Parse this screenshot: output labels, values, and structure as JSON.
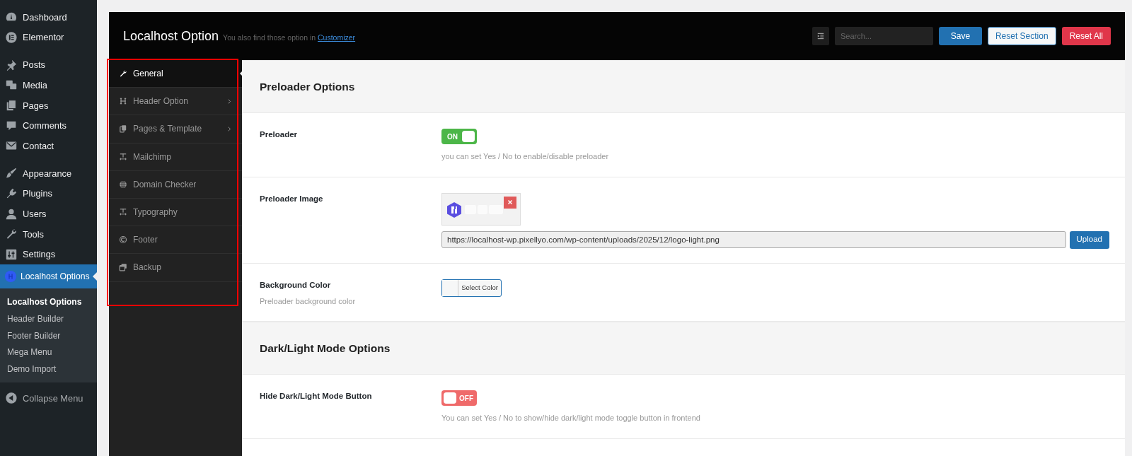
{
  "wp_menu": {
    "groups": [
      [
        {
          "label": "Dashboard",
          "selected": false
        },
        {
          "label": "Elementor",
          "selected": false
        }
      ],
      [
        {
          "label": "Posts",
          "selected": false
        },
        {
          "label": "Media",
          "selected": false
        },
        {
          "label": "Pages",
          "selected": false
        },
        {
          "label": "Comments",
          "selected": false
        },
        {
          "label": "Contact",
          "selected": false
        }
      ],
      [
        {
          "label": "Appearance",
          "selected": false
        },
        {
          "label": "Plugins",
          "selected": false
        },
        {
          "label": "Users",
          "selected": false
        },
        {
          "label": "Tools",
          "selected": false
        },
        {
          "label": "Settings",
          "selected": false
        },
        {
          "label": "Localhost Options",
          "selected": true
        }
      ]
    ],
    "submenu": [
      {
        "label": "Localhost Options",
        "selected": true
      },
      {
        "label": "Header Builder",
        "selected": false
      },
      {
        "label": "Footer Builder",
        "selected": false
      },
      {
        "label": "Mega Menu",
        "selected": false
      },
      {
        "label": "Demo Import",
        "selected": false
      }
    ],
    "collapse": "Collapse Menu"
  },
  "panel": {
    "title": "Localhost Option",
    "subtitle": "You also find those option in ",
    "subtitle_link": "Customizer",
    "search": {
      "placeholder": "Search..."
    },
    "buttons": [
      {
        "label": "Save",
        "kind": "primary"
      },
      {
        "label": "Reset Section",
        "kind": "outline"
      },
      {
        "label": "Reset All",
        "kind": "danger"
      }
    ]
  },
  "options_nav": [
    {
      "label": "General",
      "selected": true,
      "has_submenu": false
    },
    {
      "label": "Header Option",
      "selected": false,
      "has_submenu": true
    },
    {
      "label": "Pages & Template",
      "selected": false,
      "has_submenu": true
    },
    {
      "label": "Mailchimp",
      "selected": false,
      "has_submenu": false
    },
    {
      "label": "Domain Checker",
      "selected": false,
      "has_submenu": false
    },
    {
      "label": "Typography",
      "selected": false,
      "has_submenu": false
    },
    {
      "label": "Footer",
      "selected": false,
      "has_submenu": false
    },
    {
      "label": "Backup",
      "selected": false,
      "has_submenu": false
    }
  ],
  "sections": [
    {
      "title": "Preloader Options",
      "fields": [
        {
          "kind": "switch",
          "label": "Preloader",
          "on": true,
          "on_text": "ON",
          "description": "you can set Yes / No to enable/disable preloader"
        },
        {
          "kind": "media",
          "label": "Preloader Image",
          "url": "https://localhost-wp.pixellyo.com/wp-content/uploads/2025/12/logo-light.png",
          "button": "Upload"
        },
        {
          "kind": "color",
          "label": "Background Color",
          "description": "Preloader background color",
          "button": "Select Color"
        }
      ]
    },
    {
      "title": "Dark/Light Mode Options",
      "fields": [
        {
          "kind": "switch",
          "label": "Hide Dark/Light Mode Button",
          "on": false,
          "off_text": "OFF",
          "description": "You can set Yes / No to show/hide dark/light mode toggle button in frontend"
        }
      ]
    }
  ]
}
